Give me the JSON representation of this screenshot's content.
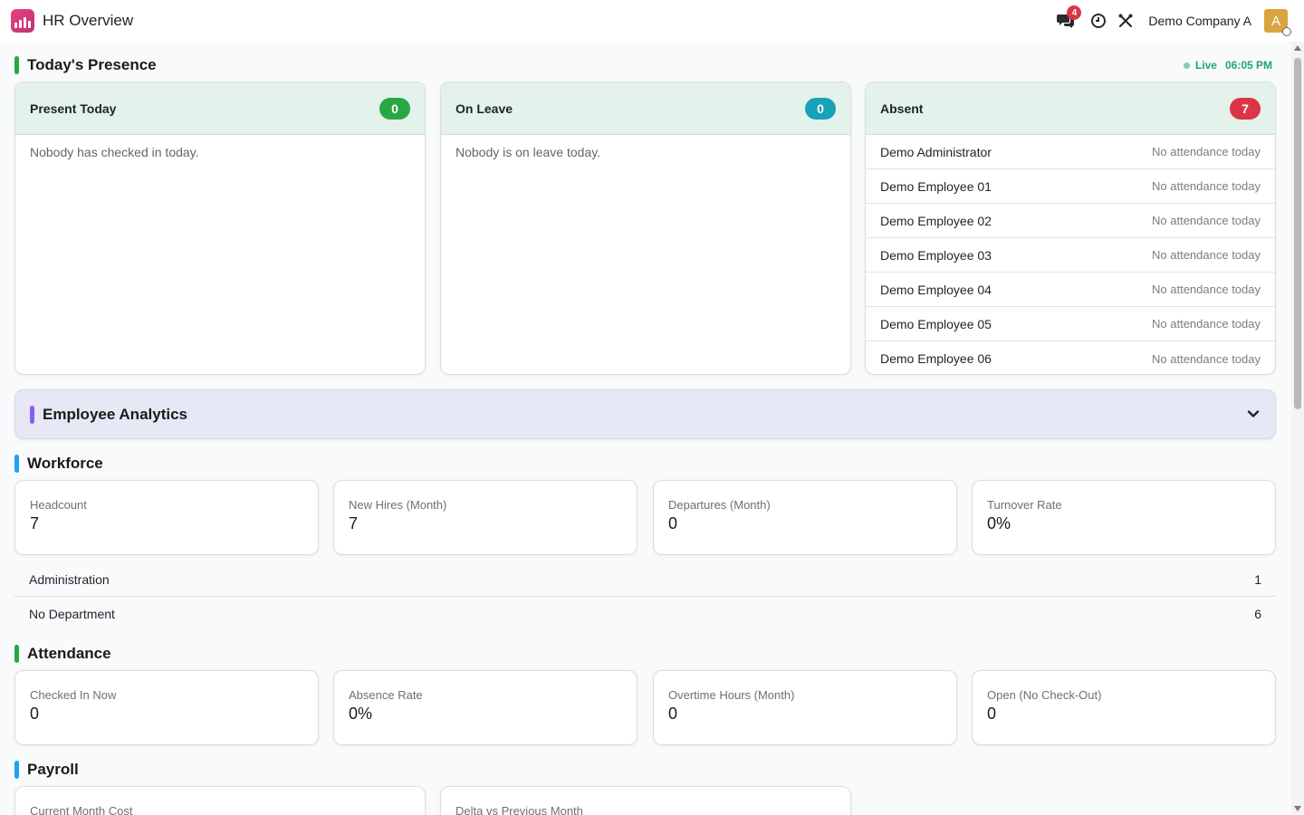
{
  "navbar": {
    "app_title": "HR Overview",
    "notifications_count": "4",
    "company": "Demo Company A",
    "avatar_letter": "A"
  },
  "presence": {
    "title": "Today's Presence",
    "live_label": "Live",
    "time": "06:05 PM",
    "present": {
      "title": "Present Today",
      "count": "0",
      "empty": "Nobody has checked in today.",
      "color": "#28a745"
    },
    "on_leave": {
      "title": "On Leave",
      "count": "0",
      "empty": "Nobody is on leave today.",
      "color": "#17a2b8"
    },
    "absent": {
      "title": "Absent",
      "count": "7",
      "color": "#dc3545",
      "rows": [
        {
          "name": "Demo Administrator",
          "status": "No attendance today"
        },
        {
          "name": "Demo Employee 01",
          "status": "No attendance today"
        },
        {
          "name": "Demo Employee 02",
          "status": "No attendance today"
        },
        {
          "name": "Demo Employee 03",
          "status": "No attendance today"
        },
        {
          "name": "Demo Employee 04",
          "status": "No attendance today"
        },
        {
          "name": "Demo Employee 05",
          "status": "No attendance today"
        },
        {
          "name": "Demo Employee 06",
          "status": "No attendance today"
        }
      ]
    }
  },
  "analytics": {
    "title": "Employee Analytics"
  },
  "workforce": {
    "title": "Workforce",
    "cards": [
      {
        "label": "Headcount",
        "value": "7"
      },
      {
        "label": "New Hires (Month)",
        "value": "7"
      },
      {
        "label": "Departures (Month)",
        "value": "0"
      },
      {
        "label": "Turnover Rate",
        "value": "0%"
      }
    ],
    "departments": [
      {
        "name": "Administration",
        "count": "1"
      },
      {
        "name": "No Department",
        "count": "6"
      }
    ]
  },
  "attendance": {
    "title": "Attendance",
    "cards": [
      {
        "label": "Checked In Now",
        "value": "0"
      },
      {
        "label": "Absence Rate",
        "value": "0%"
      },
      {
        "label": "Overtime Hours (Month)",
        "value": "0"
      },
      {
        "label": "Open (No Check-Out)",
        "value": "0"
      }
    ]
  },
  "payroll": {
    "title": "Payroll",
    "cards": [
      {
        "label": "Current Month Cost"
      },
      {
        "label": "Delta vs Previous Month"
      }
    ]
  },
  "colors": {
    "presence_bar": "#28a745",
    "workforce_bar": "#1da1f2",
    "attendance_bar": "#28a745",
    "payroll_bar": "#1da1f2",
    "analytics_bar": "#8b5cf6"
  }
}
